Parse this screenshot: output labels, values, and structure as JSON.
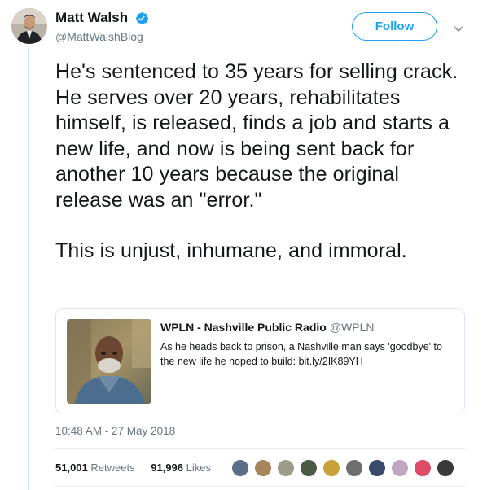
{
  "author": {
    "name": "Matt Walsh",
    "handle": "@MattWalshBlog",
    "verified": true
  },
  "follow_label": "Follow",
  "tweet": {
    "paragraph1": "He's sentenced to 35 years for selling crack. He serves over 20 years, rehabilitates himself, is released, finds a job and starts a new life, and now is being sent back for another 10 years because the original release was an \"error.\"",
    "paragraph2": "This is unjust, inhumane, and immoral."
  },
  "quoted_tweet": {
    "name": "WPLN - Nashville Public Radio",
    "handle": "@WPLN",
    "text": "As he heads back to prison, a Nashville man says 'goodbye' to the new life he hoped to build: bit.ly/2IK89YH"
  },
  "timestamp": "10:48 AM - 27 May 2018",
  "stats": {
    "retweets_count": "51,001",
    "retweets_label": "Retweets",
    "likes_count": "91,996",
    "likes_label": "Likes"
  },
  "colors": {
    "accent": "#1da1f2",
    "verified": "#1da1f2",
    "secondary_text": "#657786",
    "thread_line": "#c4e7fd"
  },
  "icons": [
    "verified-badge-icon",
    "chevron-down-icon"
  ]
}
